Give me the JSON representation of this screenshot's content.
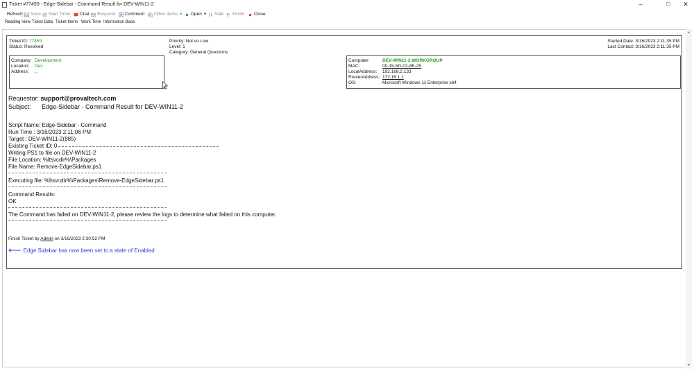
{
  "window": {
    "title": "Ticket #77459 - Edge-Sidebar - Command Result for DEV-WIN11-2",
    "controls": [
      "–",
      "□",
      "✕"
    ]
  },
  "toolbar": {
    "refresh": "Refresh",
    "save": "Save",
    "start_timer": "Start Timer",
    "chat": "Chat",
    "respond": "Respond",
    "comment": "Comment",
    "other_items": "Other Items",
    "open": "Open",
    "stall": "Stall",
    "finish": "Finish",
    "close": "Close"
  },
  "tabs": [
    "Reading View",
    "Ticket Data",
    "Ticket Items",
    "Work Time",
    "Information Base"
  ],
  "ticket": {
    "id_label": "Ticket ID:",
    "id_value": "77459",
    "status_label": "Status:",
    "status_value": "Resolved",
    "priority": "Priority: Not so Low",
    "level": "Level: 1",
    "category": "Category: General Questions",
    "started": "Started Date: 3/16/2023 2:11:35 PM",
    "last_contact": "Last Contact: 3/16/2023 2:11:35 PM"
  },
  "company_box": {
    "company_label": "Company:",
    "company_value": "Development",
    "location_label": "Location:",
    "location_value": "Dev",
    "address_label": "Address:",
    "address_value": ", ,"
  },
  "computer_box": {
    "computer_label": "Computer:",
    "computer_value": "DEV-WIN11-2.WORKGROUP",
    "mac_label": "MAC:",
    "mac_value": "00-15-5D-02-8E-25",
    "local_label": "LocalAddress:",
    "local_value": "192.168.2.133",
    "router_label": "RouterAddress:",
    "router_value": "172.16.1.1",
    "os_label": "OS:",
    "os_value": "Microsoft Windows 11 Enterprise x64"
  },
  "requestor": {
    "label": "Requestor:",
    "value": "support@provaltech.com",
    "subject_label": "Subject:",
    "subject_value": "Edge-Sidebar - Command Result for DEV-WIN11-2"
  },
  "body": {
    "script_name": " Script Name: Edge-Sidebar - Command",
    "run_time": "Run Time : 3/16/2023 2:11:06 PM",
    "target": "Target : DEV-WIN11-2(885)",
    "existing": "Existing Ticket ID: 0",
    "writing": "Writing PS1 to file on DEV-WIN11-2",
    "file_location": "File Location: %ltsvcdir%\\Packages",
    "file_name": "File Name: Remove-EdgeSidebar.ps1",
    "executing": "Executing file: %ltsvcdir%\\Packages\\Remove-EdgeSidebar.ps1",
    "command_results": "Command Results:",
    "ok": "OK",
    "failed_msg": "The Command has failed on DEV-WIN11-2, please review the logs to determine what failed on this computer."
  },
  "finish": {
    "prefix": "Finish Ticket by ",
    "user": "Admin",
    "suffix": " on 3/16/2023 2:30:52 PM"
  },
  "enabled_message": "Edge Sidebar has now been set to a state of Enabled",
  "colors": {
    "green": "#1d9a1d",
    "blue_link": "#2b3fd6"
  }
}
